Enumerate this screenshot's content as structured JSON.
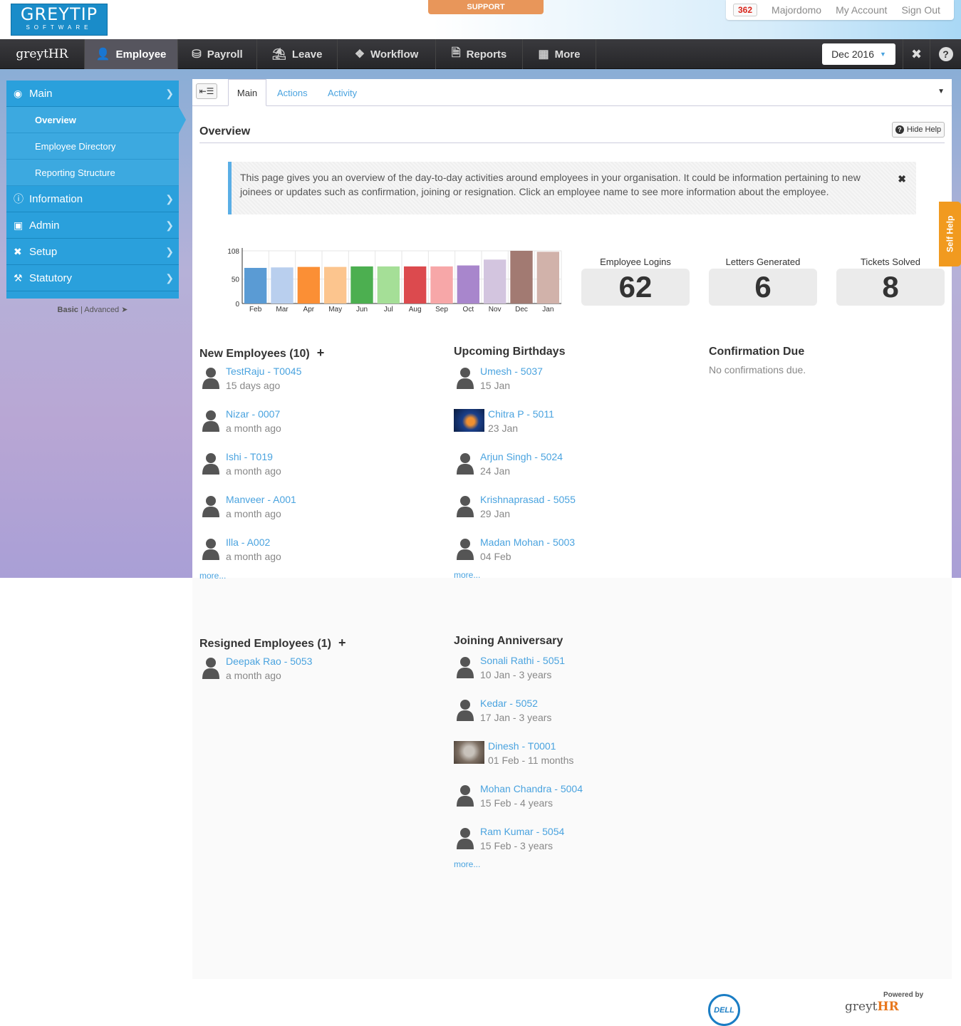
{
  "header": {
    "logo_line1": "GREYTIP",
    "logo_line2": "SOFTWARE",
    "support_label": "SUPPORT",
    "notifications_count": "362",
    "user_links": [
      "Majordomo",
      "My Account",
      "Sign Out"
    ]
  },
  "nav": {
    "brand": "greytHR",
    "items": [
      {
        "label": "Employee",
        "icon": "user-icon",
        "active": true
      },
      {
        "label": "Payroll",
        "icon": "coins-icon"
      },
      {
        "label": "Leave",
        "icon": "beach-icon"
      },
      {
        "label": "Workflow",
        "icon": "workflow-icon"
      },
      {
        "label": "Reports",
        "icon": "reports-icon"
      },
      {
        "label": "More",
        "icon": "grid-icon"
      }
    ],
    "period": "Dec 2016"
  },
  "sidebar": {
    "items": [
      {
        "label": "Main",
        "icon": "dashboard-icon"
      },
      {
        "label": "Overview",
        "sub": true,
        "selected": true
      },
      {
        "label": "Employee Directory",
        "sub": true
      },
      {
        "label": "Reporting Structure",
        "sub": true
      },
      {
        "label": "Information",
        "icon": "info-icon"
      },
      {
        "label": "Admin",
        "icon": "briefcase-icon"
      },
      {
        "label": "Setup",
        "icon": "tools-icon"
      },
      {
        "label": "Statutory",
        "icon": "gavel-icon"
      }
    ],
    "mode_basic": "Basic",
    "mode_sep": "|",
    "mode_advanced": "Advanced"
  },
  "tabs": [
    "Main",
    "Actions",
    "Activity"
  ],
  "overview": {
    "title": "Overview",
    "hide_help": "Hide Help",
    "help_text": "This page gives you an overview of the day-to-day activities around employees in your organisation. It could be information pertaining to new joinees or updates such as confirmation, joining or resignation. Click an employee name to see more information about the employee.",
    "self_help": "Self Help"
  },
  "chart_data": {
    "type": "bar",
    "categories": [
      "Feb",
      "Mar",
      "Apr",
      "May",
      "Jun",
      "Jul",
      "Aug",
      "Sep",
      "Oct",
      "Nov",
      "Dec",
      "Jan"
    ],
    "values": [
      73,
      74,
      75,
      75,
      76,
      76,
      76,
      76,
      78,
      90,
      108,
      106
    ],
    "colors": [
      "#5a9bd4",
      "#b9cfee",
      "#fb8f35",
      "#fcc58e",
      "#4caf50",
      "#a5df97",
      "#dc4a4e",
      "#f7a7a8",
      "#a886cc",
      "#d3c5df",
      "#a27a72",
      "#d1b2aa"
    ],
    "ylim": [
      0,
      108
    ],
    "yticks": [
      0,
      50,
      108
    ],
    "grid": true
  },
  "stats": [
    {
      "label": "Employee Logins",
      "value": "62"
    },
    {
      "label": "Letters Generated",
      "value": "6"
    },
    {
      "label": "Tickets Solved",
      "value": "8"
    }
  ],
  "new_employees": {
    "title": "New Employees (10)",
    "add": "+",
    "people": [
      {
        "name": "TestRaju - T0045",
        "sub": "15 days ago"
      },
      {
        "name": "Nizar - 0007",
        "sub": "a month ago"
      },
      {
        "name": "Ishi - T019",
        "sub": "a month ago"
      },
      {
        "name": "Manveer - A001",
        "sub": "a month ago"
      },
      {
        "name": "Illa - A002",
        "sub": "a month ago"
      }
    ],
    "more": "more..."
  },
  "birthdays": {
    "title": "Upcoming Birthdays",
    "people": [
      {
        "name": "Umesh - 5037",
        "sub": "15 Jan"
      },
      {
        "name": "Chitra P - 5011",
        "sub": "23 Jan",
        "photo": "jellyfish"
      },
      {
        "name": "Arjun Singh - 5024",
        "sub": "24 Jan"
      },
      {
        "name": "Krishnaprasad - 5055",
        "sub": "29 Jan"
      },
      {
        "name": "Madan Mohan - 5003",
        "sub": "04 Feb"
      }
    ],
    "more": "more..."
  },
  "confirmation": {
    "title": "Confirmation Due",
    "empty": "No confirmations due."
  },
  "resigned": {
    "title": "Resigned Employees (1)",
    "add": "+",
    "people": [
      {
        "name": "Deepak Rao - 5053",
        "sub": "a month ago"
      }
    ]
  },
  "anniversary": {
    "title": "Joining Anniversary",
    "people": [
      {
        "name": "Sonali Rathi - 5051",
        "sub": "10 Jan - 3 years"
      },
      {
        "name": "Kedar - 5052",
        "sub": "17 Jan - 3 years"
      },
      {
        "name": "Dinesh - T0001",
        "sub": "01 Feb - 11 months",
        "photo": "koala"
      },
      {
        "name": "Mohan Chandra - 5004",
        "sub": "15 Feb - 4 years"
      },
      {
        "name": "Ram Kumar - 5054",
        "sub": "15 Feb - 3 years"
      }
    ],
    "more": "more..."
  },
  "footer": {
    "dell": "DELL",
    "powered_by": "Powered by",
    "brand_grey": "greyt",
    "brand_hr": "HR"
  }
}
